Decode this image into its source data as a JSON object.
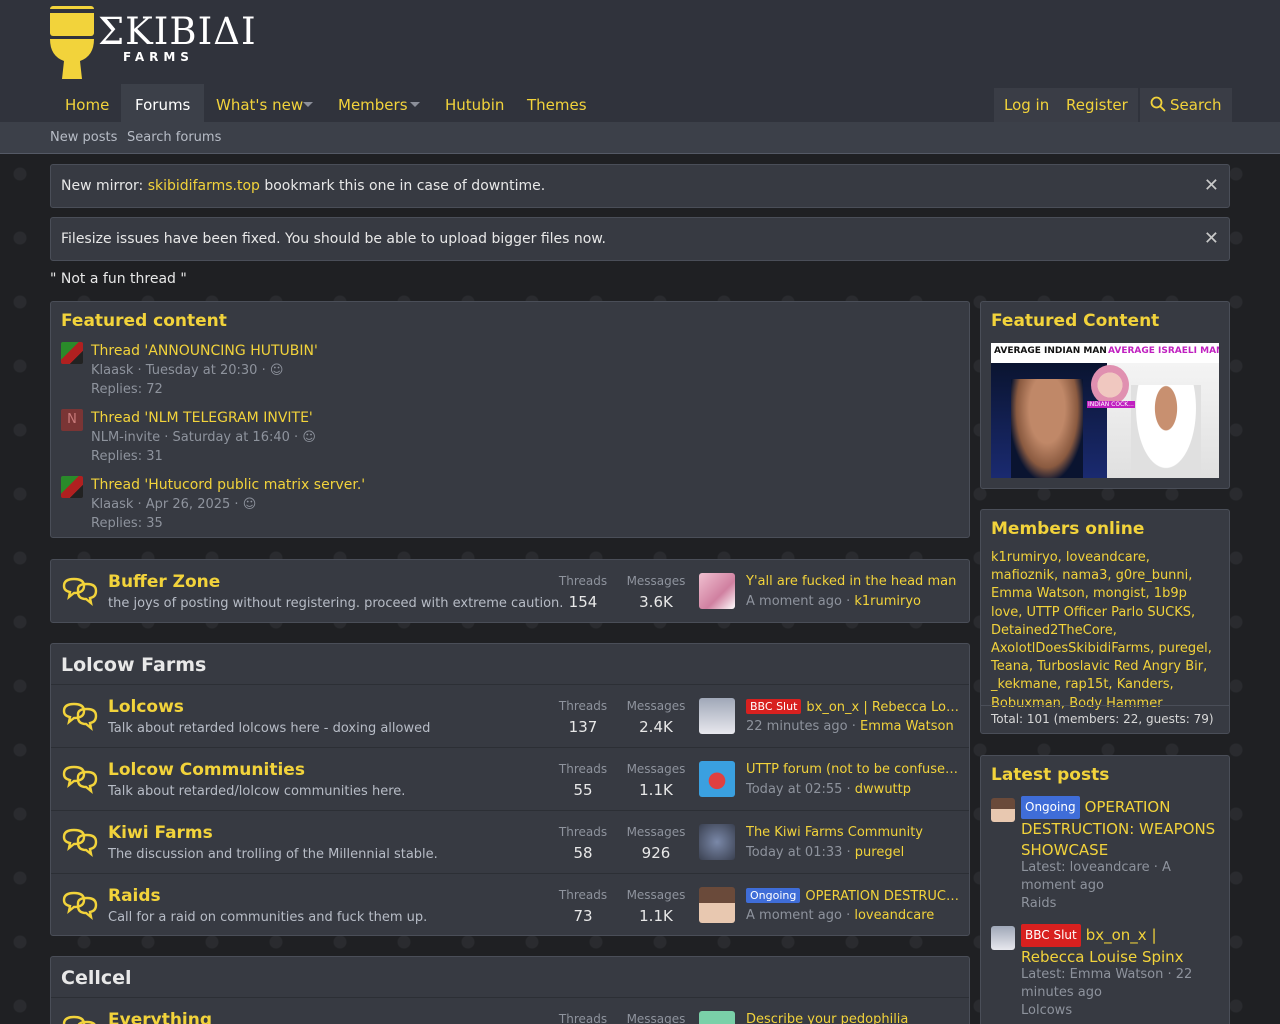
{
  "logo": {
    "main": "ΣΚΙΒΙΔΙ",
    "sub": "FARMS"
  },
  "nav": {
    "items": [
      "Home",
      "Forums",
      "What's new",
      "Members",
      "Hutubin",
      "Themes"
    ],
    "login": "Log in",
    "register": "Register",
    "search": "Search"
  },
  "subnav": {
    "new_posts": "New posts",
    "search_forums": "Search forums"
  },
  "notices": [
    {
      "prefix": "New mirror: ",
      "link": "skibidifarms.top",
      "suffix": " bookmark this one in case of downtime."
    },
    {
      "text": "Filesize issues have been fixed. You should be able to upload bigger files now."
    }
  ],
  "quote": "\" Not a fun thread \"",
  "featured": {
    "title": "Featured content",
    "items": [
      {
        "title": "Thread 'ANNOUNCING HUTUBIN'",
        "meta": "Klaask · Tuesday at 20:30 ·",
        "replies": "Replies: 72",
        "avatar": "img"
      },
      {
        "title": "Thread 'NLM TELEGRAM INVITE'",
        "meta": "NLM-invite · Saturday at 16:40 ·",
        "replies": "Replies: 31",
        "avatar": "N"
      },
      {
        "title": "Thread 'Hutucord public matrix server.'",
        "meta": "Klaask · Apr 26, 2025 ·",
        "replies": "Replies: 35",
        "avatar": "img"
      }
    ]
  },
  "buffer": {
    "name": "Buffer Zone",
    "desc": "the joys of posting without registering. proceed with extreme caution.",
    "threads_label": "Threads",
    "threads": "154",
    "messages_label": "Messages",
    "messages": "3.6K",
    "last_title": "Y'all are fucked in the head man",
    "last_time": "A moment ago",
    "last_user": "k1rumiryo"
  },
  "lolcow": {
    "title": "Lolcow Farms",
    "forums": [
      {
        "name": "Lolcows",
        "desc": "Talk about retarded lolcows here - doxing allowed",
        "threads": "137",
        "messages": "2.4K",
        "badge": "BBC Slut",
        "last_title": "bx_on_x | Rebecca Louise Spinx",
        "last_time": "22 minutes ago",
        "last_user": "Emma Watson"
      },
      {
        "name": "Lolcow Communities",
        "desc": "Talk about retarded/lolcow communities here.",
        "threads": "55",
        "messages": "1.1K",
        "badge": "",
        "last_title": "UTTP forum (not to be confused with...)",
        "last_time": "Today at 02:55",
        "last_user": "dwwuttp"
      },
      {
        "name": "Kiwi Farms",
        "desc": "The discussion and trolling of the Millennial stable.",
        "threads": "58",
        "messages": "926",
        "badge": "",
        "last_title": "The Kiwi Farms Community",
        "last_time": "Today at 01:33",
        "last_user": "puregel"
      },
      {
        "name": "Raids",
        "desc": "Call for a raid on communities and fuck them up.",
        "threads": "73",
        "messages": "1.1K",
        "badge": "Ongoing",
        "last_title": "OPERATION DESTRUCTION: WEAPONS",
        "last_time": "A moment ago",
        "last_user": "loveandcare"
      }
    ]
  },
  "cellcel": {
    "title": "Cellcel",
    "forum_name": "Everything",
    "threads_label": "Threads",
    "messages_label": "Messages",
    "last_title": "Describe your pedophilia"
  },
  "stat_labels": {
    "threads": "Threads",
    "messages": "Messages"
  },
  "sidebar": {
    "featured_title": "Featured Content",
    "featured_img_left": "AVERAGE INDIAN MAN",
    "featured_img_right": "AVERAGE ISRAELI MAN",
    "featured_img_caption": "INDIAN COCK...",
    "members_title": "Members online",
    "members": "k1rumiryo, loveandcare, mafioznik, nama3, g0re_bunni, Emma Watson, mongist, 1b9p love, UTTP Officer Parlo SUCKS, Detained2TheCore, AxolotlDoesSkibidiFarms, puregel, Teana, Turboslavic Red Angry Bir, _kekmane, rap15t, Kanders, Bobuxman, Body Hammer",
    "members_total": "Total: 101 (members: 22, guests: 79)",
    "latest_title": "Latest posts",
    "latest": [
      {
        "badge": "Ongoing",
        "title": "OPERATION DESTRUCTION: WEAPONS SHOWCASE",
        "meta": "Latest: loveandcare · A moment ago",
        "forum": "Raids"
      },
      {
        "badge": "BBC Slut",
        "title": "bx_on_x | Rebecca Louise Spinx",
        "meta": "Latest: Emma Watson · 22 minutes ago",
        "forum": "Lolcows"
      }
    ]
  },
  "colors": {
    "accent": "#f2d33b",
    "panel": "#373a42",
    "header": "#30333c",
    "badge_red": "#d8201f",
    "badge_blue": "#3f6dd8"
  }
}
